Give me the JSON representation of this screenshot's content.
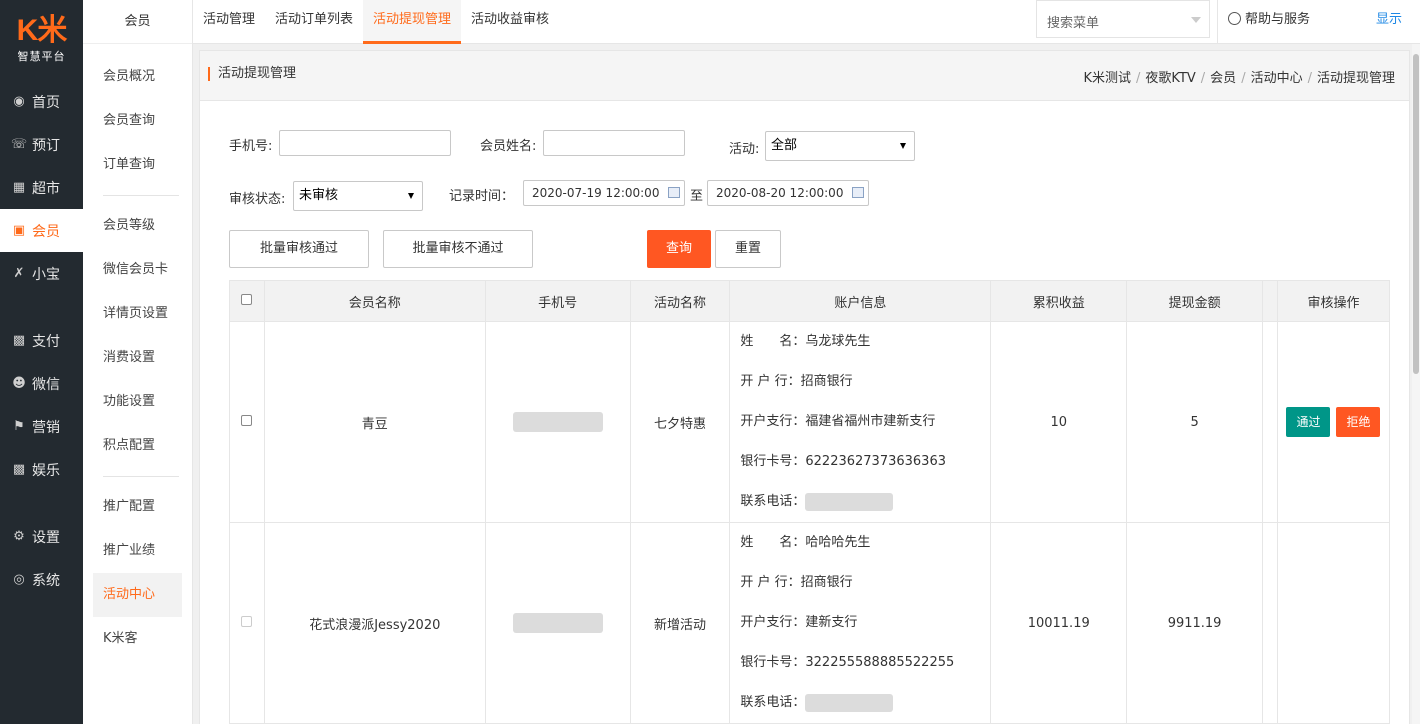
{
  "brand": {
    "logo": "K米",
    "subtitle": "智慧平台"
  },
  "nav": [
    {
      "label": "首页",
      "icon": "dashboard-icon"
    },
    {
      "label": "预订",
      "icon": "phone-icon"
    },
    {
      "label": "超市",
      "icon": "basket-icon"
    },
    {
      "label": "会员",
      "icon": "card-icon",
      "active": true
    },
    {
      "label": "小宝",
      "icon": "k-icon"
    },
    {
      "label": "支付",
      "icon": "money-icon"
    },
    {
      "label": "微信",
      "icon": "wechat-icon"
    },
    {
      "label": "营销",
      "icon": "megaphone-icon"
    },
    {
      "label": "娱乐",
      "icon": "lock-icon"
    },
    {
      "label": "设置",
      "icon": "gears-icon"
    },
    {
      "label": "系统",
      "icon": "chrome-icon"
    }
  ],
  "subnav": {
    "header": "会员",
    "items": [
      "会员概况",
      "会员查询",
      "订单查询",
      "会员等级",
      "微信会员卡",
      "详情页设置",
      "消费设置",
      "功能设置",
      "积点配置",
      "推广配置",
      "推广业绩",
      "活动中心",
      "K米客"
    ]
  },
  "tabs": [
    "活动管理",
    "活动订单列表",
    "活动提现管理",
    "活动收益审核"
  ],
  "topbar": {
    "search_placeholder": "搜索菜单",
    "help": "帮助与服务",
    "show": "显示"
  },
  "panel": {
    "title": "活动提现管理",
    "breadcrumb": [
      "K米测试",
      "夜歌KTV",
      "会员",
      "活动中心",
      "活动提现管理"
    ]
  },
  "filters": {
    "phone_label": "手机号:",
    "phone_value": "",
    "name_label": "会员姓名:",
    "name_value": "",
    "activity_label": "活动:",
    "activity_value": "全部",
    "status_label": "审核状态:",
    "status_value": "未审核",
    "time_label": "记录时间：",
    "time_from": "2020-07-19 12:00:00",
    "time_sep": "至",
    "time_to": "2020-08-20 12:00:00"
  },
  "buttons": {
    "batch_pass": "批量审核通过",
    "batch_reject": "批量审核不通过",
    "query": "查询",
    "reset": "重置"
  },
  "table": {
    "headers": [
      "会员名称",
      "手机号",
      "活动名称",
      "账户信息",
      "累积收益",
      "提现金额",
      "审核操作"
    ],
    "rows": [
      {
        "member": "青豆",
        "activity": "七夕特惠",
        "acct_name": "姓　　名：乌龙球先生",
        "acct_bank": "开 户 行：招商银行",
        "acct_branch": "开户支行：福建省福州市建新支行",
        "acct_card": "银行卡号：62223627373636363",
        "acct_phone": "联系电话：",
        "earned": "10",
        "withdraw": "5",
        "pass": "通过",
        "reject": "拒绝"
      },
      {
        "member": "花式浪漫派Jessy2020",
        "activity": "新增活动",
        "acct_name": "姓　　名：哈哈哈先生",
        "acct_bank": "开 户 行：招商银行",
        "acct_branch": "开户支行：建新支行",
        "acct_card": "银行卡号：322255588885522255",
        "acct_phone": "联系电话：",
        "earned": "10011.19",
        "withdraw": "9911.19"
      }
    ]
  }
}
